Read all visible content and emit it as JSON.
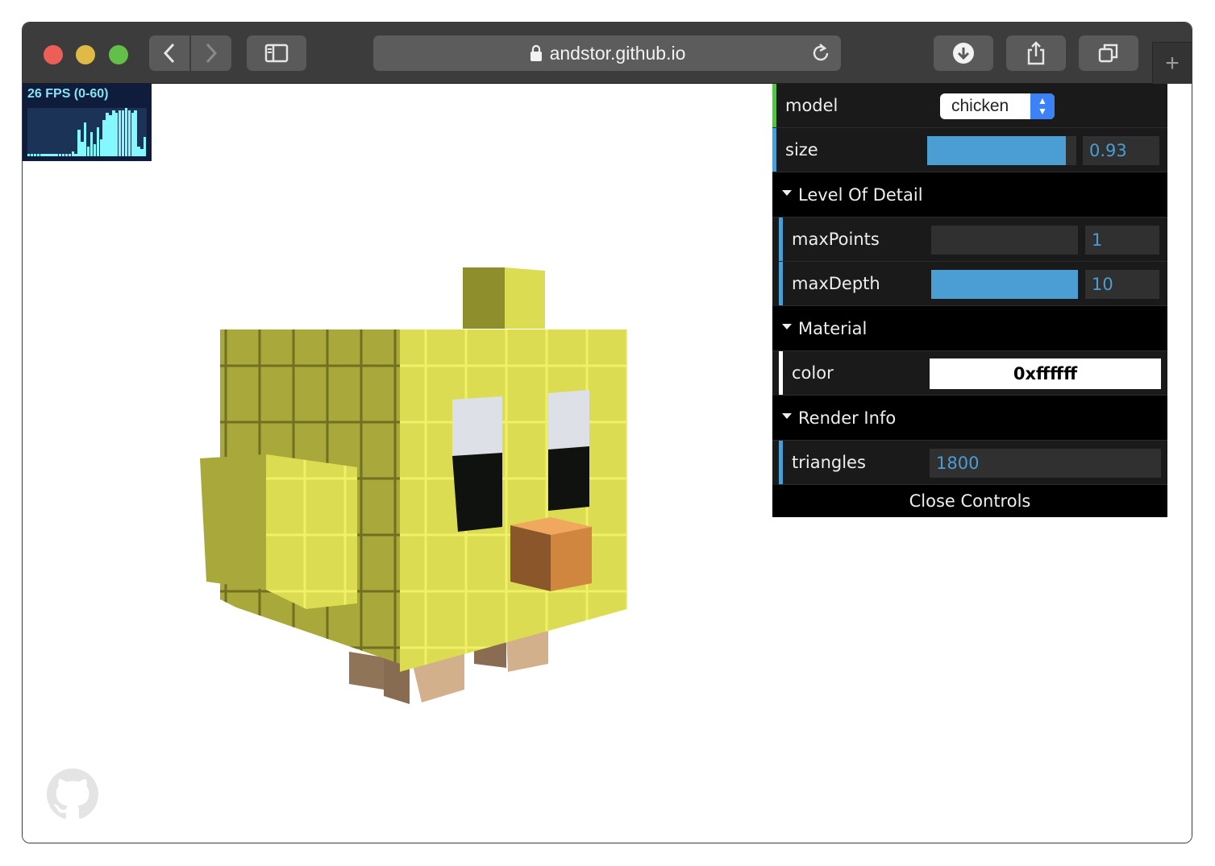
{
  "browser": {
    "url": "andstor.github.io",
    "new_tab_symbol": "+"
  },
  "stats": {
    "fps_label": "26 FPS (0-60)",
    "graph_levels": [
      0.05,
      0.05,
      0.05,
      0.05,
      0.05,
      0.05,
      0.05,
      0.05,
      0.05,
      0.05,
      0.05,
      0.05,
      0.05,
      0.05,
      0.1,
      0.05,
      0.55,
      0.3,
      0.7,
      0.2,
      0.5,
      0.25,
      0.6,
      0.35,
      0.75,
      0.9,
      0.85,
      0.95,
      0.9,
      0.95,
      0.95,
      1,
      0.95,
      0.9,
      0.95,
      0.2,
      0.15,
      0.4
    ]
  },
  "gui": {
    "model": {
      "label": "model",
      "value": "chicken"
    },
    "size": {
      "label": "size",
      "value": "0.93",
      "fraction": 0.93
    },
    "level_of_detail": {
      "title": "Level Of Detail",
      "max_points": {
        "label": "maxPoints",
        "value": "1",
        "fraction": 0.0
      },
      "max_depth": {
        "label": "maxDepth",
        "value": "10",
        "fraction": 1.0
      }
    },
    "material": {
      "title": "Material",
      "color": {
        "label": "color",
        "value": "0xffffff"
      }
    },
    "render_info": {
      "title": "Render Info",
      "triangles": {
        "label": "triangles",
        "value": "1800"
      }
    },
    "close_label": "Close Controls"
  },
  "colors": {
    "accent_blue": "#4a9ed4",
    "model_stripe": "#57c04b",
    "chicken_yellow": "#dcdc52",
    "beak_orange": "#d0863e",
    "feet_tan": "#d2b08c"
  },
  "icons": {
    "lock": "lock-icon",
    "reload": "reload-icon",
    "github": "github-icon"
  }
}
